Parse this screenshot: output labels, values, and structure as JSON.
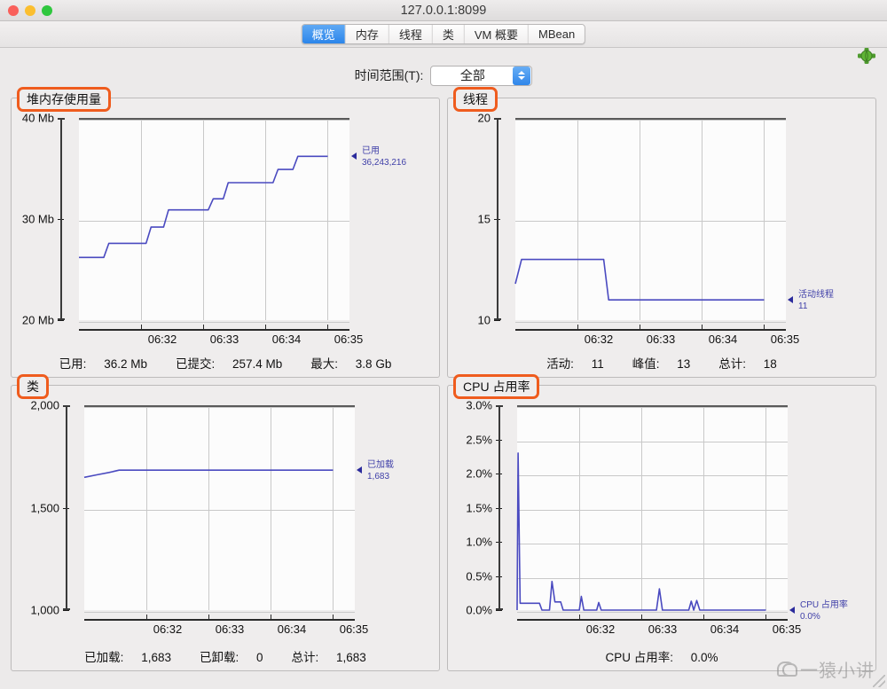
{
  "window": {
    "title": "127.0.0.1:8099",
    "traffic_lights": [
      "close-red",
      "minimize-yellow",
      "zoom-green"
    ]
  },
  "tabs": [
    {
      "label": "概览",
      "active": true
    },
    {
      "label": "内存",
      "active": false
    },
    {
      "label": "线程",
      "active": false
    },
    {
      "label": "类",
      "active": false
    },
    {
      "label": "VM 概要",
      "active": false
    },
    {
      "label": "MBean",
      "active": false
    }
  ],
  "toolbar": {
    "add_node_icon": "green-plus-node-icon"
  },
  "time_range": {
    "label": "时间范围(T):",
    "value": "全部"
  },
  "watermark": {
    "text": "一猿小讲",
    "icon": "wechat-icon"
  },
  "chart_data": [
    {
      "type": "line",
      "id": "heap-memory",
      "title": "堆内存使用量",
      "title_highlighted": true,
      "ylabel": "",
      "xlabel": "",
      "yticks": [
        "20 Mb",
        "30 Mb",
        "40 Mb"
      ],
      "ylim": [
        20,
        40
      ],
      "xticks": [
        "06:32",
        "06:33",
        "06:34",
        "06:35"
      ],
      "grid": true,
      "legend_position": "right",
      "series": [
        {
          "name": "已用",
          "value_label": "36,243,216",
          "color": "#4a4ac0",
          "points": [
            [
              0.0,
              26.2
            ],
            [
              0.1,
              26.2
            ],
            [
              0.12,
              27.6
            ],
            [
              0.27,
              27.6
            ],
            [
              0.29,
              29.2
            ],
            [
              0.34,
              29.2
            ],
            [
              0.36,
              30.9
            ],
            [
              0.52,
              30.9
            ],
            [
              0.54,
              32.0
            ],
            [
              0.58,
              32.0
            ],
            [
              0.6,
              33.6
            ],
            [
              0.78,
              33.6
            ],
            [
              0.8,
              34.9
            ],
            [
              0.86,
              34.9
            ],
            [
              0.88,
              36.2
            ],
            [
              1.0,
              36.2
            ]
          ]
        }
      ],
      "footer": [
        {
          "label": "已用:",
          "value": "36.2 Mb"
        },
        {
          "label": "已提交:",
          "value": "257.4 Mb"
        },
        {
          "label": "最大:",
          "value": "3.8 Gb"
        }
      ]
    },
    {
      "type": "line",
      "id": "threads",
      "title": "线程",
      "title_highlighted": true,
      "ylabel": "",
      "xlabel": "",
      "yticks": [
        "10",
        "15",
        "20"
      ],
      "ylim": [
        10,
        20
      ],
      "xticks": [
        "06:32",
        "06:33",
        "06:34",
        "06:35"
      ],
      "grid": true,
      "legend_position": "right",
      "series": [
        {
          "name": "活动线程",
          "value_label": "11",
          "color": "#4a4ac0",
          "points": [
            [
              0.0,
              11.8
            ],
            [
              0.025,
              13.0
            ],
            [
              0.355,
              13.0
            ],
            [
              0.375,
              11.0
            ],
            [
              1.0,
              11.0
            ]
          ]
        }
      ],
      "footer": [
        {
          "label": "活动:",
          "value": "11"
        },
        {
          "label": "峰值:",
          "value": "13"
        },
        {
          "label": "总计:",
          "value": "18"
        }
      ]
    },
    {
      "type": "line",
      "id": "classes",
      "title": "类",
      "title_highlighted": true,
      "ylabel": "",
      "xlabel": "",
      "yticks": [
        "1,000",
        "1,500",
        "2,000"
      ],
      "ylim": [
        1000,
        2000
      ],
      "xticks": [
        "06:32",
        "06:33",
        "06:34",
        "06:35"
      ],
      "grid": true,
      "legend_position": "right",
      "series": [
        {
          "name": "已加载",
          "value_label": "1,683",
          "color": "#4a4ac0",
          "points": [
            [
              0.0,
              1648
            ],
            [
              0.05,
              1660
            ],
            [
              0.1,
              1672
            ],
            [
              0.14,
              1683
            ],
            [
              1.0,
              1683
            ]
          ]
        }
      ],
      "footer": [
        {
          "label": "已加载:",
          "value": "1,683"
        },
        {
          "label": "已卸载:",
          "value": "0"
        },
        {
          "label": "总计:",
          "value": "1,683"
        }
      ]
    },
    {
      "type": "line",
      "id": "cpu-usage",
      "title": "CPU 占用率",
      "title_highlighted": true,
      "ylabel": "",
      "xlabel": "",
      "yticks": [
        "0.0%",
        "0.5%",
        "1.0%",
        "1.5%",
        "2.0%",
        "2.5%",
        "3.0%"
      ],
      "ylim": [
        0,
        3
      ],
      "xticks": [
        "06:32",
        "06:33",
        "06:34",
        "06:35"
      ],
      "grid": true,
      "legend_position": "right",
      "series": [
        {
          "name": "CPU 占用率",
          "value_label": "0.0%",
          "color": "#4a4ac0",
          "points": [
            [
              0.0,
              0.0
            ],
            [
              0.004,
              2.3
            ],
            [
              0.012,
              0.1
            ],
            [
              0.09,
              0.1
            ],
            [
              0.1,
              0.0
            ],
            [
              0.13,
              0.0
            ],
            [
              0.14,
              0.42
            ],
            [
              0.152,
              0.12
            ],
            [
              0.175,
              0.12
            ],
            [
              0.185,
              0.0
            ],
            [
              0.25,
              0.0
            ],
            [
              0.258,
              0.2
            ],
            [
              0.268,
              0.0
            ],
            [
              0.32,
              0.0
            ],
            [
              0.328,
              0.11
            ],
            [
              0.338,
              0.0
            ],
            [
              0.56,
              0.0
            ],
            [
              0.572,
              0.31
            ],
            [
              0.584,
              0.0
            ],
            [
              0.69,
              0.0
            ],
            [
              0.7,
              0.13
            ],
            [
              0.71,
              0.0
            ],
            [
              0.722,
              0.14
            ],
            [
              0.734,
              0.0
            ],
            [
              1.0,
              0.0
            ]
          ]
        }
      ],
      "footer": [
        {
          "label": "CPU 占用率:",
          "value": "0.0%"
        }
      ]
    }
  ]
}
